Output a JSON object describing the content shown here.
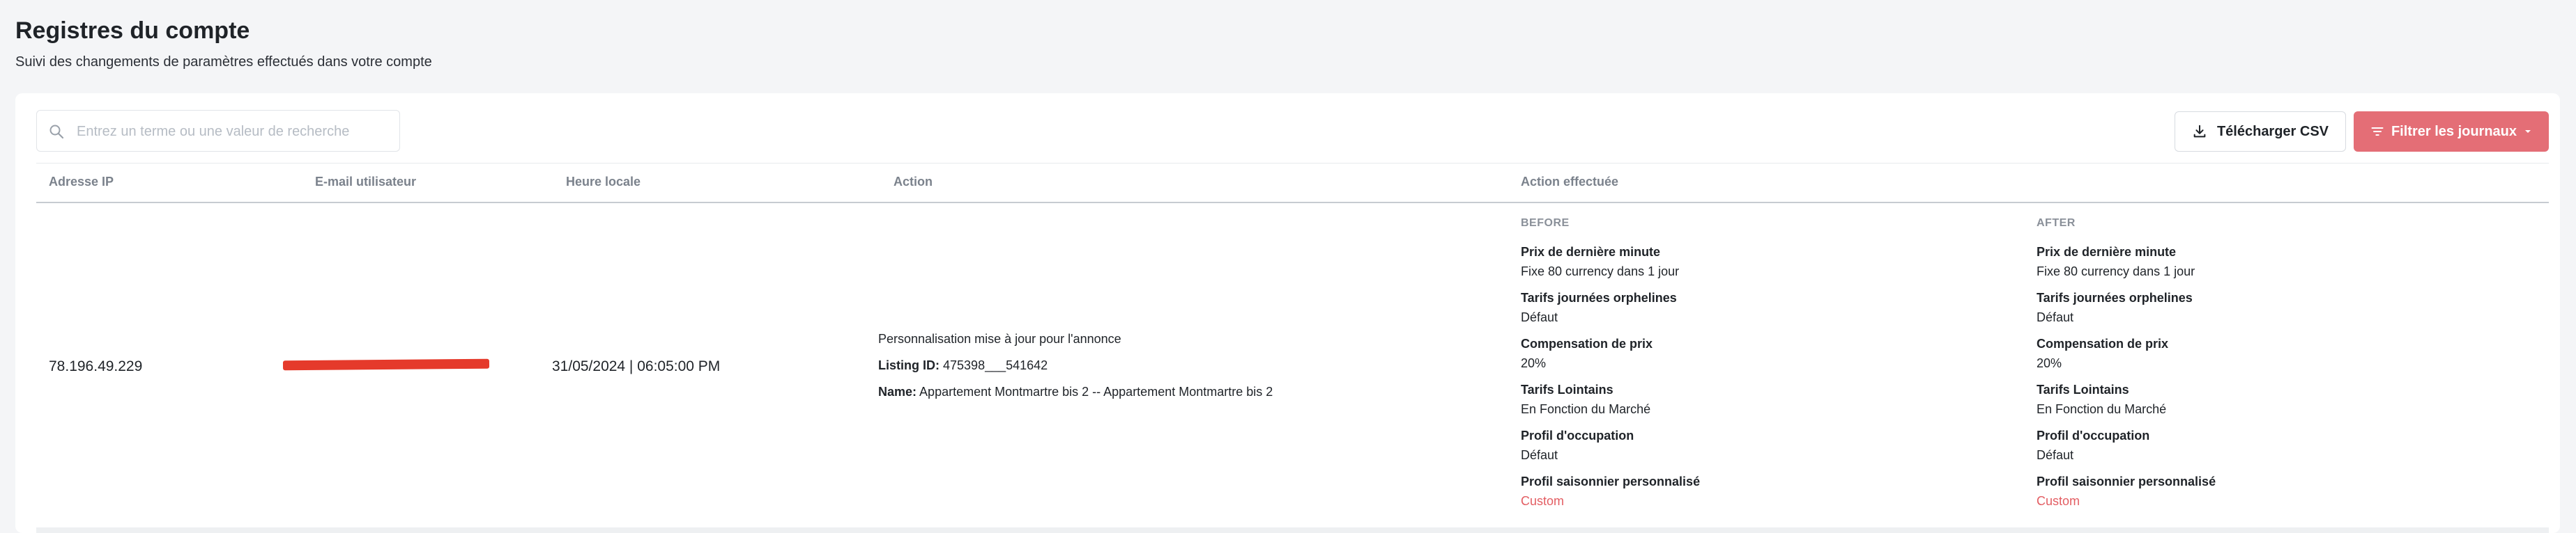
{
  "header": {
    "title": "Registres du compte",
    "subtitle": "Suivi des changements de paramètres effectués dans votre compte"
  },
  "search": {
    "placeholder": "Entrez un terme ou une valeur de recherche",
    "value": ""
  },
  "toolbar": {
    "download_label": "Télécharger CSV",
    "filter_label": "Filtrer les journaux"
  },
  "table": {
    "columns": [
      "Adresse IP",
      "E-mail utilisateur",
      "Heure locale",
      "Action",
      "Action effectuée"
    ],
    "rows": [
      {
        "ip": "78.196.49.229",
        "email": "redacted",
        "local_time": "31/05/2024 | 06:05:00 PM",
        "action": {
          "title": "Personnalisation mise à jour pour l'annonce",
          "listing_label": "Listing ID:",
          "listing_id": "475398___541642",
          "name_label": "Name:",
          "name": "Appartement Montmartre bis 2 -- Appartement Montmartre bis 2"
        },
        "before_label": "BEFORE",
        "after_label": "AFTER",
        "before": [
          {
            "label": "Prix de dernière minute",
            "value": "Fixe 80 currency dans 1 jour"
          },
          {
            "label": "Tarifs journées orphelines",
            "value": "Défaut"
          },
          {
            "label": "Compensation de prix",
            "value": "20%"
          },
          {
            "label": "Tarifs Lointains",
            "value": "En Fonction du Marché"
          },
          {
            "label": "Profil d'occupation",
            "value": "Défaut"
          },
          {
            "label": "Profil saisonnier personnalisé",
            "value": "Custom"
          }
        ],
        "after": [
          {
            "label": "Prix de dernière minute",
            "value": "Fixe 80 currency dans 1 jour"
          },
          {
            "label": "Tarifs journées orphelines",
            "value": "Défaut"
          },
          {
            "label": "Compensation de prix",
            "value": "20%"
          },
          {
            "label": "Tarifs Lointains",
            "value": "En Fonction du Marché"
          },
          {
            "label": "Profil d'occupation",
            "value": "Défaut"
          },
          {
            "label": "Profil saisonnier personnalisé",
            "value": "Custom"
          }
        ]
      }
    ]
  },
  "colors": {
    "accent": "#e46e76",
    "accent_text": "#e35d62",
    "redaction": "#e53a2b"
  }
}
